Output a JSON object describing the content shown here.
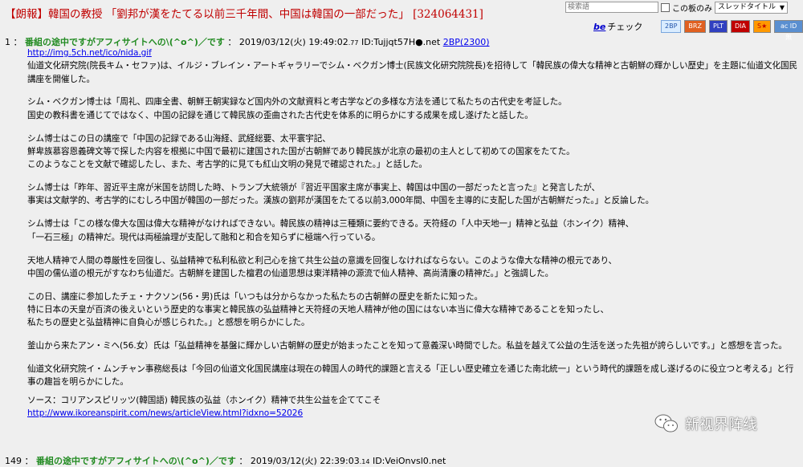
{
  "thread": {
    "title": "【朗報】韓国の教授 「劉邦が漢をたてる以前三千年間、中国は韓国の一部だった」 [324064431]"
  },
  "search": {
    "placeholder": "検索語",
    "only_this_board": "この板のみ",
    "scope_selected": "スレッドタイトル"
  },
  "be_check": {
    "be_label": "be",
    "suffix": "チェック"
  },
  "share_buttons": [
    {
      "label": "2BP",
      "color": "#d9ecff"
    },
    {
      "label": "BRZ",
      "color": "#e06020"
    },
    {
      "label": "PLT",
      "color": "#3040c0"
    },
    {
      "label": "DIA",
      "color": "#c00000"
    },
    {
      "label": "S★",
      "color": "#ff9900"
    },
    {
      "label": "ac ID無",
      "color": "#5a8fd0"
    }
  ],
  "posts": [
    {
      "number": "1",
      "name": "番組の途中ですがアフィサイトへの\\(^o^)／です",
      "date": "2019/03/12(火) 19:49:02",
      "date_fraction": ".77",
      "id": "ID:Tujjqt57H●.net",
      "be_link": "2BP(2300)",
      "image_url": "http://img.5ch.net/ico/nida.gif",
      "paragraphs": [
        "仙道文化研究院(院長キム・セファ)は、イルジ・ブレイン・アートギャラリーでシム・ベクガン博士(民族文化研究院院長)を招待して「韓民族の偉大な精神と古朝鮮の輝かしい歴史」を主題に仙道文化国民講座を開催した。",
        "シム・ベクガン博士は「周礼、四庫全書、朝鮮王朝実録など国内外の文献資料と考古学などの多様な方法を通じて私たちの古代史を考証した。\n国史の教科書を通じてではなく、中国の記録を通じて韓民族の歪曲された古代史を体系的に明らかにする成果を成し遂げたと話した。",
        "シム博士はこの日の講座で「中国の記録である山海経、武経総要、太平寰宇記、\n鮮卑族慕容恩義碑文等で探した内容を根拠に中国で最初に建国された国が古朝鮮であり韓民族が北京の最初の主人として初めての国家をたてた。\nこのようなことを文献で確認したし、また、考古学的に見ても紅山文明の発見で確認された。」と話した。",
        "シム博士は「昨年、習近平主席が米国を訪問した時、トランプ大統領が『習近平国家主席が事実上、韓国は中国の一部だったと言った』と発言したが、\n事実は文献学的、考古学的にむしろ中国が韓国の一部だった。漢族の劉邦が漢国をたてる以前3,000年間、中国を主導的に支配した国が古朝鮮だった。」と反論した。",
        "シム博士は「この様な偉大な国は偉大な精神がなければできない。韓民族の精神は三種類に要約できる。天符経の「人中天地一」精神と弘益（ホンイク）精神、\n「一石三極」の精神だ。現代は両極論理が支配して融和と和合を知らずに極端へ行っている。",
        "天地人精神で人間の尊厳性を回復し、弘益精神で私利私欲と利己心を捨て共生公益の意識を回復しなければならない。このような偉大な精神の根元であり、\n中国の儒仏道の根元がすなわち仙道だ。古朝鮮を建国した檀君の仙道思想は東洋精神の源流で仙人精神、高尚清廉の精神だ。」と強調した。",
        "この日、講座に参加したチェ・ナクソン(56・男)氏は「いつもは分からなかった私たちの古朝鮮の歴史を新たに知った。\n特に日本の天皇が百済の後えいという歴史的な事実と韓民族の弘益精神と天符経の天地人精神が他の国にはない本当に偉大な精神であることを知ったし、\n私たちの歴史と弘益精神に自負心が感じられた。」と感想を明らかにした。",
        "釜山から来たアン・ミヘ(56.女）氏は「弘益精神を基盤に輝かしい古朝鮮の歴史が始まったことを知って意義深い時間でした。私益を越えて公益の生活を送った先祖が誇らしいです。」と感想を言った。",
        "仙道文化研究院イ・ムンチャン事務総長は「今回の仙道文化国民講座は現在の韓国人の時代的課題と言える「正しい歴史確立を通じた南北統一」という時代的課題を成し遂げるのに役立つと考える」と行事の趣旨を明らかにした。"
      ],
      "source_label": "ソース：コリアンスピリッツ(韓国語) 韓民族の弘益（ホンイク）精神で共生公益を企ててこそ",
      "source_url": "http://www.ikoreanspirit.com/news/articleView.html?idxno=52026"
    },
    {
      "number": "149",
      "name": "番組の途中ですがアフィサイトへの\\(^o^)／です",
      "date": "2019/03/12(火) 22:39:03",
      "date_fraction": ".14",
      "id": "ID:VeiOnvsl0.net"
    }
  ],
  "watermark": {
    "text": "新视界阵线",
    "icon": "wechat-icon"
  }
}
